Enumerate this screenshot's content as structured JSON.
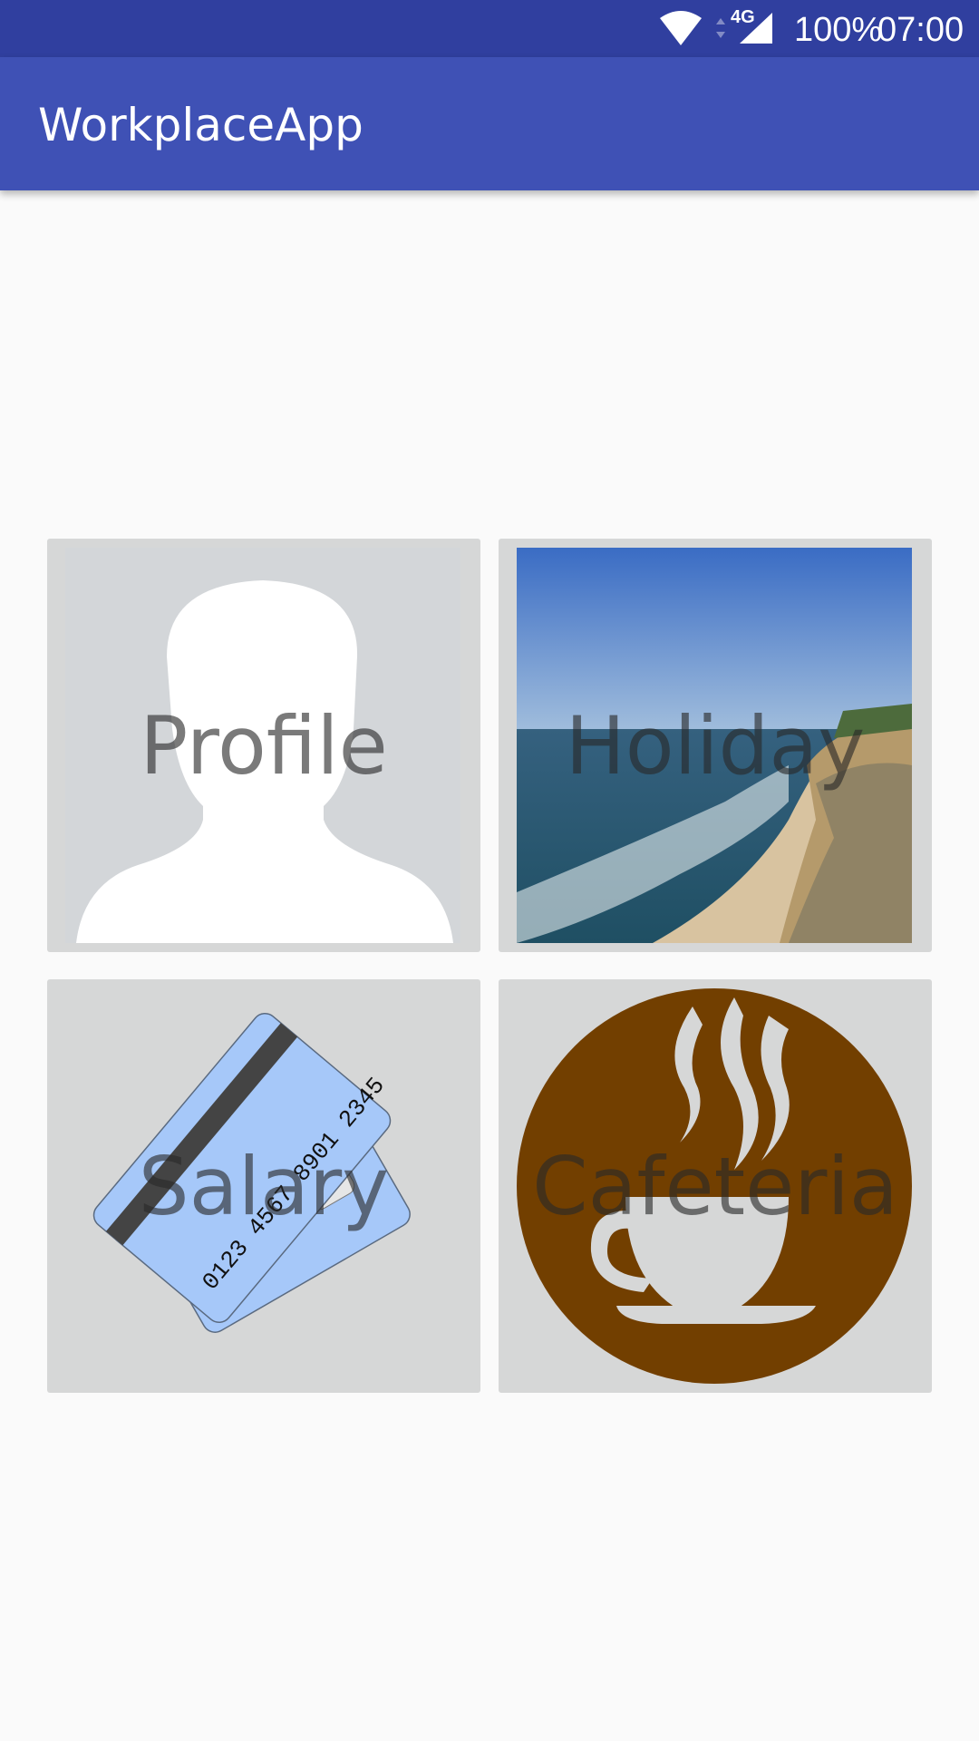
{
  "status_bar": {
    "network": "4G",
    "battery": "100%",
    "time": "07:00",
    "icons": [
      "wifi-icon",
      "signal-icon"
    ]
  },
  "app_bar": {
    "title": "WorkplaceApp"
  },
  "tiles": [
    {
      "label": "Profile",
      "icon": "profile-silhouette"
    },
    {
      "label": "Holiday",
      "icon": "beach-photo"
    },
    {
      "label": "Salary",
      "icon": "credit-cards",
      "card_numbers": "0123 4567 8901 2345"
    },
    {
      "label": "Cafeteria",
      "icon": "coffee-cup"
    }
  ],
  "colors": {
    "status_bar": "#303f9f",
    "app_bar": "#3f51b5",
    "tile_bg": "#d6d7d7",
    "coffee": "#723f00"
  }
}
